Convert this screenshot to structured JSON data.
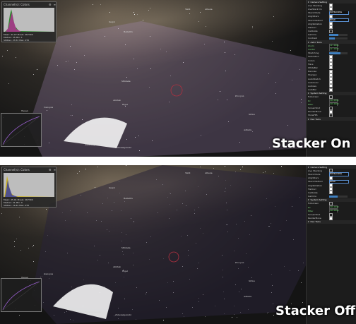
{
  "panels": [
    {
      "caption": "Stacker On",
      "histogram": {
        "channel_label": "Channel(s): Colors",
        "stats": [
          "Mean: 41.07  Pixels: 267300",
          "Median: 35  Min: 1",
          "StdDev: 23.53  Max: 255",
          "Std dev: 16.55  Percentile: 155"
        ]
      },
      "star_labels": [
        "Tabit",
        "Alhena",
        "Saiph",
        "Bellatrix",
        "Mintaka",
        "Alnitak",
        "Rigel",
        "Procyon",
        "Sirius",
        "Adhara",
        "Wezen",
        "Canopus",
        "Zubenelgenubi",
        "Zubenelgenubi"
      ],
      "settings": [
        {
          "type": "section",
          "label": "Camera Setting"
        },
        {
          "type": "check",
          "label": "Live Stacking",
          "on": true
        },
        {
          "type": "check",
          "label": "LiveStack On",
          "on": true
        },
        {
          "type": "select",
          "label": "Stack Mode",
          "value": "NOTRACKING"
        },
        {
          "type": "check",
          "label": "AlignStars",
          "on": true
        },
        {
          "type": "select",
          "label": "Stack Method",
          "value": "MEAN"
        },
        {
          "type": "check",
          "label": "AlignRotation",
          "on": true
        },
        {
          "type": "check",
          "label": "FlatCorr",
          "on": true
        },
        {
          "type": "check",
          "label": "Calibrate",
          "on": false
        },
        {
          "type": "slider",
          "label": "Gamma",
          "level": 0.5
        },
        {
          "type": "slider",
          "label": "Contrast",
          "level": 0.3
        },
        {
          "type": "section",
          "label": "Astro Tools"
        },
        {
          "type": "value",
          "label": "Zoom",
          "value": "127.0000"
        },
        {
          "type": "value",
          "label": "Center",
          "value": "127.0000"
        },
        {
          "type": "slider",
          "label": "Stretching",
          "level": 0.6
        },
        {
          "type": "check",
          "label": "Saturation",
          "on": true
        },
        {
          "type": "check",
          "label": "Colors",
          "on": true
        },
        {
          "type": "check",
          "label": "Flare",
          "on": true
        },
        {
          "type": "check",
          "label": "WhiteBal",
          "on": true
        },
        {
          "type": "check",
          "label": "Denoise",
          "on": true
        },
        {
          "type": "check",
          "label": "Sharpen",
          "on": true
        },
        {
          "type": "check",
          "label": "AutoStretch",
          "on": true
        },
        {
          "type": "check",
          "label": "AutoColor",
          "on": true
        },
        {
          "type": "check",
          "label": "AutoLev",
          "on": true
        },
        {
          "type": "check",
          "label": "AutoBal",
          "on": true
        },
        {
          "type": "section",
          "label": "System Setting"
        },
        {
          "type": "check",
          "label": "Fullscreen",
          "on": false
        },
        {
          "type": "value",
          "label": "Rc",
          "value": "100.0000"
        },
        {
          "type": "value",
          "label": "Filter",
          "value": "100.0000"
        },
        {
          "type": "check",
          "label": "ScreenShot",
          "on": false
        },
        {
          "type": "check",
          "label": "RenderMove",
          "on": true
        },
        {
          "type": "check",
          "label": "ShowFPS",
          "on": false
        },
        {
          "type": "section",
          "label": "Dev Tools"
        }
      ]
    },
    {
      "caption": "Stacker Off",
      "histogram": {
        "channel_label": "Channel(s): Colors",
        "stats": [
          "Mean: 25.91  Pixels: 267300",
          "Median: 21  Min: 0",
          "StdDev: 19.42  Max: 255",
          "Std dev: 12.30  Percentile: 100"
        ]
      },
      "star_labels": [
        "Tabit",
        "Alhena",
        "Saiph",
        "Bellatrix",
        "Mintaka",
        "Alnitak",
        "Rigel",
        "Procyon",
        "Sirius",
        "Adhara",
        "Wezen",
        "Canopus",
        "Zubenelgenubi",
        "Zubenelgenubi"
      ],
      "settings": [
        {
          "type": "section",
          "label": "Camera Setting"
        },
        {
          "type": "check",
          "label": "Live Stacking",
          "on": false
        },
        {
          "type": "select",
          "label": "Stack Mode",
          "value": "NOTRACKING"
        },
        {
          "type": "check",
          "label": "AlignStars",
          "on": true
        },
        {
          "type": "select",
          "label": "Stack Method",
          "value": "MEAN"
        },
        {
          "type": "check",
          "label": "AlignRotation",
          "on": true
        },
        {
          "type": "check",
          "label": "FlatCorr",
          "on": true
        },
        {
          "type": "check",
          "label": "Calibrate",
          "on": true
        },
        {
          "type": "slider",
          "label": "Gamma",
          "level": 0.45
        },
        {
          "type": "section",
          "label": "System Setting"
        },
        {
          "type": "check",
          "label": "Fullscreen",
          "on": false
        },
        {
          "type": "value",
          "label": "Rc",
          "value": "100.0000"
        },
        {
          "type": "value",
          "label": "Filter",
          "value": "100.0000"
        },
        {
          "type": "check",
          "label": "ScreenShot",
          "on": false
        },
        {
          "type": "check",
          "label": "RenderMove",
          "on": true
        },
        {
          "type": "section",
          "label": "Dev Tools"
        }
      ]
    }
  ],
  "colors": {
    "panel_bg": "#1c1c1c",
    "accent": "#3f7fbf",
    "value_green": "#6cdf6c",
    "reticle": "#b03040"
  }
}
